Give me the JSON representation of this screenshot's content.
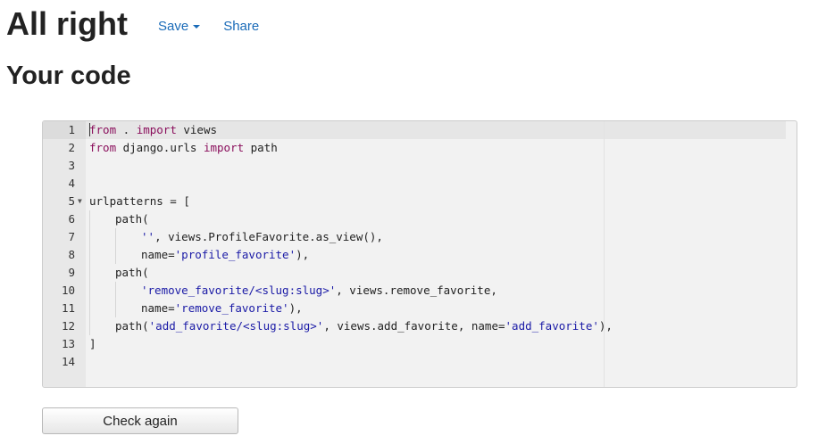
{
  "header": {
    "title": "All right",
    "save_label": "Save",
    "share_label": "Share"
  },
  "section": {
    "title": "Your code"
  },
  "editor": {
    "lines": [
      {
        "num": "1"
      },
      {
        "num": "2"
      },
      {
        "num": "3"
      },
      {
        "num": "4"
      },
      {
        "num": "5"
      },
      {
        "num": "6"
      },
      {
        "num": "7"
      },
      {
        "num": "8"
      },
      {
        "num": "9"
      },
      {
        "num": "10"
      },
      {
        "num": "11"
      },
      {
        "num": "12"
      },
      {
        "num": "13"
      },
      {
        "num": "14"
      }
    ],
    "tokens": {
      "l1_from": "from",
      "l1_mid": " . ",
      "l1_import": "import",
      "l1_rest": " views",
      "l2_from": "from",
      "l2_mid": " django.urls ",
      "l2_import": "import",
      "l2_rest": " path",
      "l5": "urlpatterns = [",
      "l6": "path(",
      "l7_str": "''",
      "l7_rest": ", views.ProfileFavorite.as_view(),",
      "l8_a": "name=",
      "l8_str": "'profile_favorite'",
      "l8_b": "),",
      "l9": "path(",
      "l10_str": "'remove_favorite/<slug:slug>'",
      "l10_rest": ", views.remove_favorite,",
      "l11_a": "name=",
      "l11_str": "'remove_favorite'",
      "l11_b": "),",
      "l12_a": "path(",
      "l12_str1": "'add_favorite/<slug:slug>'",
      "l12_b": ", views.add_favorite, name=",
      "l12_str2": "'add_favorite'",
      "l12_c": "),",
      "l13": "]"
    },
    "fold_icon": "fold-arrow-icon"
  },
  "actions": {
    "check_label": "Check again"
  }
}
